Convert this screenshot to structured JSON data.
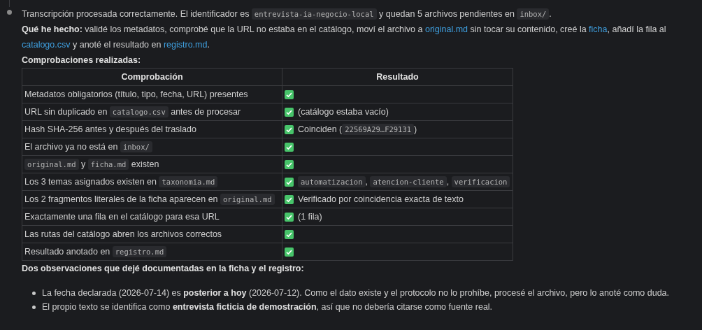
{
  "summary": [
    {
      "kind": "text",
      "text": "Transcripción procesada correctamente. El identificador es "
    },
    {
      "kind": "code",
      "text": "entrevista-ia-negocio-local"
    },
    {
      "kind": "text",
      "text": " y quedan 5 archivos pendientes en "
    },
    {
      "kind": "code",
      "text": "inbox/"
    },
    {
      "kind": "text",
      "text": "."
    }
  ],
  "done": [
    {
      "kind": "bold",
      "text": "Qué he hecho:"
    },
    {
      "kind": "text",
      "text": " validé los metadatos, comprobé que la URL no estaba en el catálogo, moví el archivo a "
    },
    {
      "kind": "link",
      "text": "original.md"
    },
    {
      "kind": "text",
      "text": " sin tocar su contenido, creé la "
    },
    {
      "kind": "link",
      "text": "ficha"
    },
    {
      "kind": "text",
      "text": ", añadí la fila al "
    },
    {
      "kind": "link",
      "text": "catalogo.csv"
    },
    {
      "kind": "text",
      "text": " y anoté el resultado en "
    },
    {
      "kind": "link",
      "text": "registro.md"
    },
    {
      "kind": "text",
      "text": "."
    }
  ],
  "checks_heading": "Comprobaciones realizadas:",
  "table": {
    "columns": [
      "Comprobación",
      "Resultado"
    ],
    "rows": [
      {
        "check": [
          {
            "kind": "text",
            "text": "Metadatos obligatorios (título, tipo, fecha, URL) presentes"
          }
        ],
        "passed": true,
        "result": []
      },
      {
        "check": [
          {
            "kind": "text",
            "text": "URL sin duplicado en "
          },
          {
            "kind": "code",
            "text": "catalogo.csv"
          },
          {
            "kind": "text",
            "text": " antes de procesar"
          }
        ],
        "passed": true,
        "result": [
          {
            "kind": "text",
            "text": "(catálogo estaba vacío)"
          }
        ]
      },
      {
        "check": [
          {
            "kind": "text",
            "text": "Hash SHA-256 antes y después del traslado"
          }
        ],
        "passed": true,
        "result": [
          {
            "kind": "text",
            "text": "Coinciden ("
          },
          {
            "kind": "code",
            "text": "22569A29…F29131"
          },
          {
            "kind": "text",
            "text": ")"
          }
        ]
      },
      {
        "check": [
          {
            "kind": "text",
            "text": "El archivo ya no está en "
          },
          {
            "kind": "code",
            "text": "inbox/"
          }
        ],
        "passed": true,
        "result": []
      },
      {
        "check": [
          {
            "kind": "code",
            "text": "original.md"
          },
          {
            "kind": "text",
            "text": " y "
          },
          {
            "kind": "code",
            "text": "ficha.md"
          },
          {
            "kind": "text",
            "text": " existen"
          }
        ],
        "passed": true,
        "result": []
      },
      {
        "check": [
          {
            "kind": "text",
            "text": "Los 3 temas asignados existen en "
          },
          {
            "kind": "code",
            "text": "taxonomia.md"
          }
        ],
        "passed": true,
        "result": [
          {
            "kind": "code",
            "text": "automatizacion"
          },
          {
            "kind": "text",
            "text": ", "
          },
          {
            "kind": "code",
            "text": "atencion-cliente"
          },
          {
            "kind": "text",
            "text": ", "
          },
          {
            "kind": "code",
            "text": "verificacion"
          }
        ]
      },
      {
        "check": [
          {
            "kind": "text",
            "text": "Los 2 fragmentos literales de la ficha aparecen en "
          },
          {
            "kind": "code",
            "text": "original.md"
          }
        ],
        "passed": true,
        "result": [
          {
            "kind": "text",
            "text": "Verificado por coincidencia exacta de texto"
          }
        ]
      },
      {
        "check": [
          {
            "kind": "text",
            "text": "Exactamente una fila en el catálogo para esa URL"
          }
        ],
        "passed": true,
        "result": [
          {
            "kind": "text",
            "text": "(1 fila)"
          }
        ]
      },
      {
        "check": [
          {
            "kind": "text",
            "text": "Las rutas del catálogo abren los archivos correctos"
          }
        ],
        "passed": true,
        "result": []
      },
      {
        "check": [
          {
            "kind": "text",
            "text": "Resultado anotado en "
          },
          {
            "kind": "code",
            "text": "registro.md"
          }
        ],
        "passed": true,
        "result": []
      }
    ]
  },
  "notes_heading": "Dos observaciones que dejé documentadas en la ficha y el registro:",
  "notes": [
    "La fecha declarada (2026-07-14) es **posterior a hoy** (2026-07-12). Como el dato existe y el protocolo no lo prohíbe, procesé el archivo, pero lo anoté como duda.",
    "El propio texto se identifica como **entrevista ficticia de demostración**, así que no debería citarse como fuente real."
  ]
}
